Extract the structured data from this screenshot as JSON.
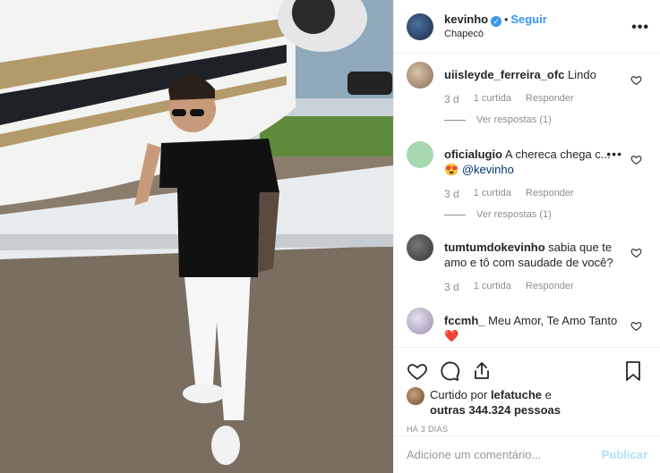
{
  "post": {
    "username": "kevinho",
    "verified_icon": "verified-badge-icon",
    "separator": "•",
    "follow_label": "Seguir",
    "location": "Chapecó",
    "more_icon": "more-options-icon"
  },
  "comments": [
    {
      "user": "uiisleyde_ferreira_ofc",
      "text": "Lindo",
      "time": "3 d",
      "likes": "1 curtida",
      "reply": "Responder",
      "view_replies": "Ver respostas (1)",
      "avatar_color": "#b7a48f"
    },
    {
      "user": "oficialugio",
      "text": "A chereca chega c...",
      "emoji": "😍",
      "mention": "@kevinho",
      "time": "3 d",
      "likes": "1 curtida",
      "reply": "Responder",
      "view_replies": "Ver respostas (1)",
      "avatar_color": "#a8d8b0"
    },
    {
      "user": "tumtumdokevinho",
      "text": "sabia que te amo e tô com saudade de você?",
      "time": "3 d",
      "likes": "1 curtida",
      "reply": "Responder",
      "avatar_color": "#555555"
    },
    {
      "user": "fccmh_",
      "text": "Meu Amor, Te Amo Tanto",
      "emoji": "❤️",
      "avatar_color": "#c9c4d8"
    }
  ],
  "liked_by": {
    "prefix": "Curtido por",
    "user": "lefatuche",
    "and": "e",
    "others": "outras 344.324 pessoas"
  },
  "time_ago": "HÁ 3 DIAS",
  "comment_input": {
    "placeholder": "Adicione um comentário...",
    "publish_label": "Publicar"
  },
  "colors": {
    "accent": "#3897f0",
    "publish_disabled": "#b2dffc"
  }
}
